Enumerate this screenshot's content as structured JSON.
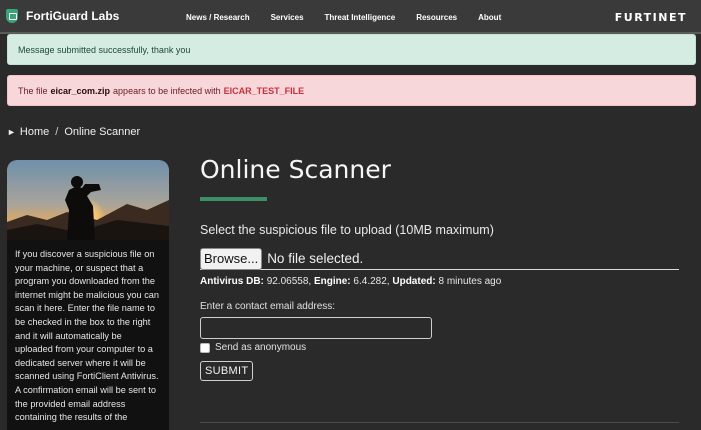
{
  "nav": {
    "brand": "FortiGuard Labs",
    "links": [
      "News / Research",
      "Services",
      "Threat Intelligence",
      "Resources",
      "About"
    ],
    "logo_text": "FURTINET"
  },
  "alerts": {
    "success": "Message submitted successfully, thank you",
    "danger": {
      "prefix": "The file",
      "filename": "eicar_com.zip",
      "middle": "appears to be infected with",
      "threat": "EICAR_TEST_FILE"
    }
  },
  "breadcrumb": {
    "home": "Home",
    "separator": "/",
    "current": "Online Scanner"
  },
  "sidebar": {
    "text": "If you discover a suspicious file on your machine, or suspect that a program you downloaded from the internet might be malicious you can scan it here. Enter the file name to be checked in the box to the right and it will automatically be uploaded from your computer to a dedicated server where it will be scanned using FortiClient Antivirus. A confirmation email will be sent to the provided email address containing the results of the"
  },
  "main": {
    "title": "Online Scanner",
    "select_label": "Select the suspicious file to upload (10MB maximum)",
    "browse_label": "Browse...",
    "file_status": "No file selected.",
    "av_db_label": "Antivirus DB:",
    "av_db_value": "92.06558,",
    "engine_label": "Engine:",
    "engine_value": "6.4.282,",
    "updated_label": "Updated:",
    "updated_value": "8 minutes ago",
    "email_label": "Enter a contact email address:",
    "email_value": "",
    "anon_label": "Send as anonymous",
    "submit_label": "SUBMIT"
  },
  "colors": {
    "accent": "#3a8f64",
    "threat": "#d02f3d",
    "success_bg": "#d4ece1",
    "danger_bg": "#f7d7da"
  }
}
